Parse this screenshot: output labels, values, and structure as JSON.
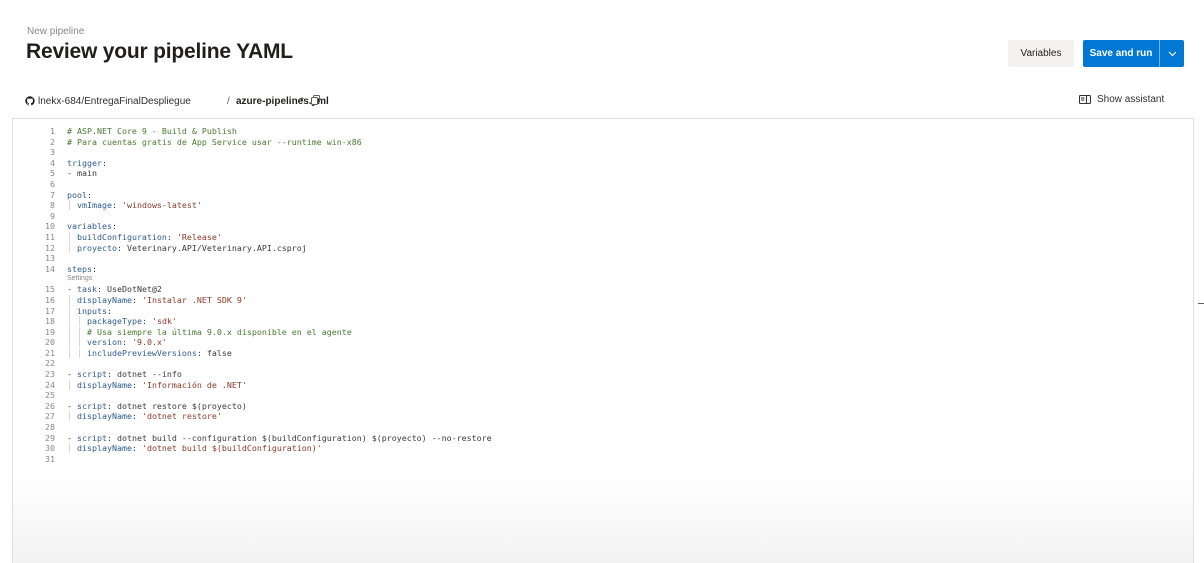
{
  "header": {
    "breadcrumb": "New pipeline",
    "title": "Review your pipeline YAML",
    "variables_label": "Variables",
    "save_run_label": "Save and run"
  },
  "repo_bar": {
    "repo": "lnekx-684/EntregaFinalDespliegue",
    "separator": "/",
    "file": "azure-pipelines.yml",
    "modified_marker": "*",
    "assistant_label": "Show assistant"
  },
  "editor": {
    "settings_link": "Settings",
    "lines": [
      {
        "n": "1",
        "t": "# ASP.NET Core 9 - Build & Publish"
      },
      {
        "n": "2",
        "t": "# Para cuentas gratis de App Service usar --runtime win-x86"
      },
      {
        "n": "3",
        "t": ""
      },
      {
        "n": "4",
        "t": "trigger:"
      },
      {
        "n": "5",
        "t": "- main"
      },
      {
        "n": "6",
        "t": ""
      },
      {
        "n": "7",
        "t": "pool:"
      },
      {
        "n": "8",
        "t": "  vmImage: 'windows-latest'"
      },
      {
        "n": "9",
        "t": ""
      },
      {
        "n": "10",
        "t": "variables:"
      },
      {
        "n": "11",
        "t": "  buildConfiguration: 'Release'"
      },
      {
        "n": "12",
        "t": "  proyecto: Veterinary.API/Veterinary.API.csproj"
      },
      {
        "n": "13",
        "t": ""
      },
      {
        "n": "14",
        "t": "steps:"
      },
      {
        "n": "15",
        "t": "- task: UseDotNet@2"
      },
      {
        "n": "16",
        "t": "  displayName: 'Instalar .NET SDK 9'"
      },
      {
        "n": "17",
        "t": "  inputs:"
      },
      {
        "n": "18",
        "t": "    packageType: 'sdk'"
      },
      {
        "n": "19",
        "t": "    # Usa siempre la última 9.0.x disponible en el agente"
      },
      {
        "n": "20",
        "t": "    version: '9.0.x'"
      },
      {
        "n": "21",
        "t": "    includePreviewVersions: false"
      },
      {
        "n": "22",
        "t": ""
      },
      {
        "n": "23",
        "t": "- script: dotnet --info"
      },
      {
        "n": "24",
        "t": "  displayName: 'Información de .NET'"
      },
      {
        "n": "25",
        "t": ""
      },
      {
        "n": "26",
        "t": "- script: dotnet restore $(proyecto)"
      },
      {
        "n": "27",
        "t": "  displayName: 'dotnet restore'"
      },
      {
        "n": "28",
        "t": ""
      },
      {
        "n": "29",
        "t": "- script: dotnet build --configuration $(buildConfiguration) $(proyecto) --no-restore"
      },
      {
        "n": "30",
        "t": "  displayName: 'dotnet build $(buildConfiguration)'"
      },
      {
        "n": "31",
        "t": ""
      }
    ]
  },
  "colors": {
    "primary_button": "#0078d4",
    "comment": "#4a7a32",
    "key": "#2f5c8f",
    "string": "#8a3a2a"
  },
  "icons": {
    "repo": "github-icon",
    "copy": "copy-icon",
    "assistant": "assistant-panel-icon",
    "split": "chevron-down-icon"
  }
}
